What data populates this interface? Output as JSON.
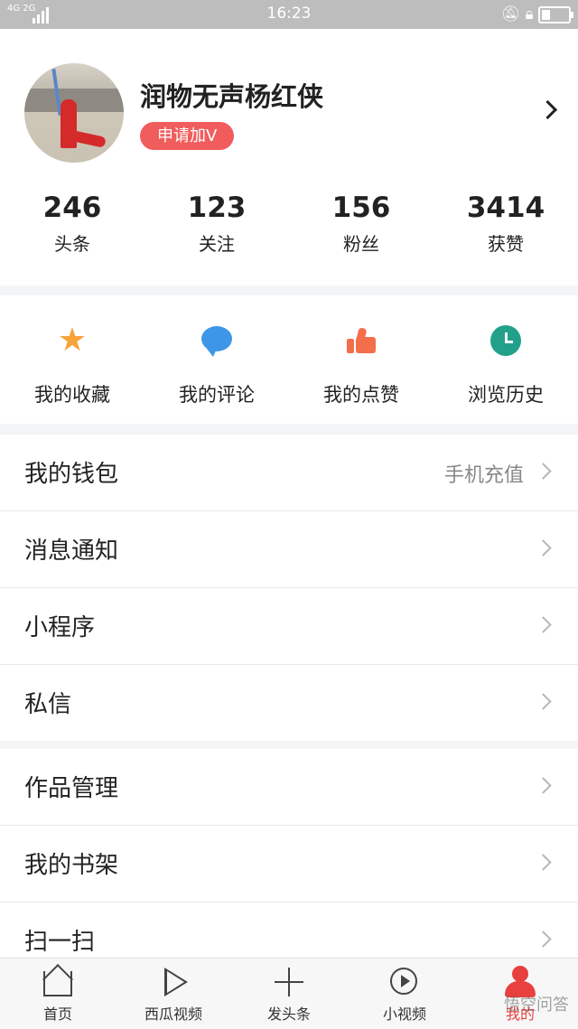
{
  "status_bar": {
    "network": "4G 2G",
    "time": "16:23"
  },
  "profile": {
    "username": "润物无声杨红侠",
    "badge": "申请加V",
    "stats": [
      {
        "value": "246",
        "label": "头条"
      },
      {
        "value": "123",
        "label": "关注"
      },
      {
        "value": "156",
        "label": "粉丝"
      },
      {
        "value": "3414",
        "label": "获赞"
      }
    ]
  },
  "quick_actions": [
    {
      "label": "我的收藏",
      "icon": "star-icon",
      "color": "#f7a23b"
    },
    {
      "label": "我的评论",
      "icon": "comment-icon",
      "color": "#3e97e6"
    },
    {
      "label": "我的点赞",
      "icon": "thumbs-up-icon",
      "color": "#f36f4c"
    },
    {
      "label": "浏览历史",
      "icon": "clock-icon",
      "color": "#23a08a"
    }
  ],
  "menu_group_1": [
    {
      "label": "我的钱包",
      "sub": "手机充值"
    },
    {
      "label": "消息通知"
    },
    {
      "label": "小程序"
    },
    {
      "label": "私信"
    }
  ],
  "menu_group_2": [
    {
      "label": "作品管理"
    },
    {
      "label": "我的书架"
    },
    {
      "label": "扫一扫"
    }
  ],
  "bottom_nav": [
    {
      "label": "首页",
      "icon": "home-icon"
    },
    {
      "label": "西瓜视频",
      "icon": "play-icon"
    },
    {
      "label": "发头条",
      "icon": "plus-icon"
    },
    {
      "label": "小视频",
      "icon": "short-video-icon"
    },
    {
      "label": "我的",
      "icon": "profile-icon",
      "active": true
    }
  ],
  "watermark": "悟空问答",
  "accent_color": "#e8403f"
}
